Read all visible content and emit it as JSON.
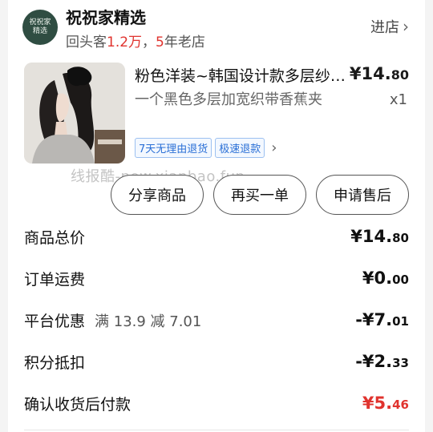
{
  "store": {
    "logo_text": "祝祝家精选",
    "name": "祝祝家精选",
    "repeat_prefix": "回头客",
    "repeat_count": "1.2万",
    "sep": "，",
    "years": "5",
    "years_suffix": "年老店",
    "enter_label": "进店",
    "enter_chevron": "›"
  },
  "product": {
    "image_icon": "product-photo-hair-clip",
    "title": "粉色洋装~韩国设计款多层纱网发抓夹",
    "price_int": "¥14.",
    "price_dec": "80",
    "spec": "一个黑色多层加宽织带香蕉夹",
    "qty": "x1",
    "tags": [
      "7天无理由退货",
      "极速退款"
    ],
    "tags_chevron": "›"
  },
  "watermark": "线报酷-new.xianbao.fun",
  "actions": {
    "share": "分享商品",
    "rebuy": "再买一单",
    "after_sale": "申请售后"
  },
  "summary": {
    "total_label": "商品总价",
    "total_int": "¥14.",
    "total_dec": "80",
    "shipping_label": "订单运费",
    "shipping_int": "¥0.",
    "shipping_dec": "00",
    "discount_label": "平台优惠",
    "discount_note": "满 13.9 减 7.01",
    "discount_int": "-¥7.",
    "discount_dec": "01",
    "points_label": "积分抵扣",
    "points_int": "-¥2.",
    "points_dec": "33",
    "pay_label": "确认收货后付款",
    "pay_int": "¥5.",
    "pay_dec": "46"
  },
  "colors": {
    "accent_red": "#e0332e",
    "tag_blue": "#2a6fd6",
    "logo_green": "#2f4d42"
  }
}
